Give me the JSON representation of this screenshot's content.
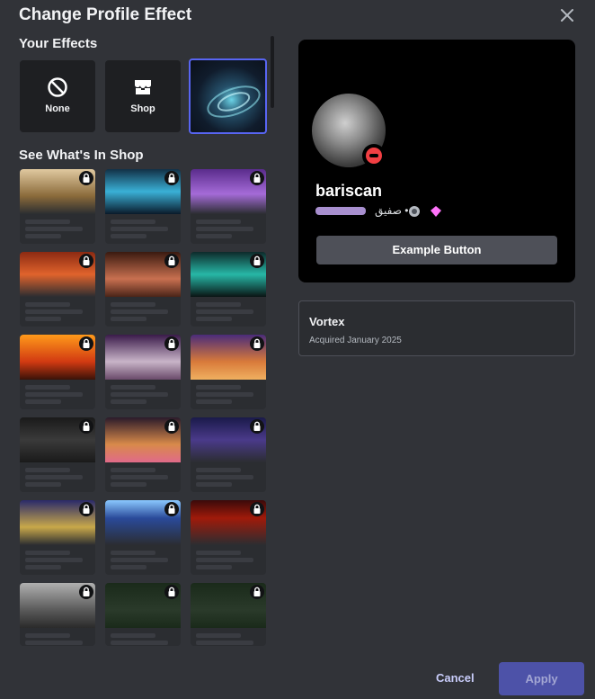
{
  "modal": {
    "title": "Change Profile Effect",
    "your_effects_label": "Your Effects",
    "shop_section_label": "See What's In Shop"
  },
  "your_effects": [
    {
      "label": "None",
      "icon": "no-entry-icon"
    },
    {
      "label": "Shop",
      "icon": "shop-icon"
    },
    {
      "label": "",
      "icon": "vortex-effect-thumbnail",
      "selected": true
    }
  ],
  "shop_items": [
    {
      "theme": "angel-wings-gold"
    },
    {
      "theme": "blue-lightning"
    },
    {
      "theme": "purple-storm"
    },
    {
      "theme": "red-flames"
    },
    {
      "theme": "fire-dragon"
    },
    {
      "theme": "green-electric-hero"
    },
    {
      "theme": "explosive-hero"
    },
    {
      "theme": "anime-characters"
    },
    {
      "theme": "pixel-windmill"
    },
    {
      "theme": "flowers-and-fruit"
    },
    {
      "theme": "pixel-pies"
    },
    {
      "theme": "cyan-lightsaber"
    },
    {
      "theme": "green-lightsaber"
    },
    {
      "theme": "blue-speed-lines"
    },
    {
      "theme": "red-hud"
    },
    {
      "theme": "grey-character"
    },
    {
      "theme": "fortnite-f-green"
    },
    {
      "theme": "fortnite-f-green-2"
    }
  ],
  "preview": {
    "username": "bariscan",
    "status_text": "صفيق •",
    "example_button_label": "Example Button"
  },
  "selected_effect": {
    "name": "Vortex",
    "acquired": "Acquired January 2025"
  },
  "footer": {
    "cancel_label": "Cancel",
    "apply_label": "Apply"
  },
  "colors": {
    "background": "#313338",
    "accent": "#5865f2",
    "apply_disabled": "#4d52a8",
    "dnd_red": "#f23f43"
  }
}
